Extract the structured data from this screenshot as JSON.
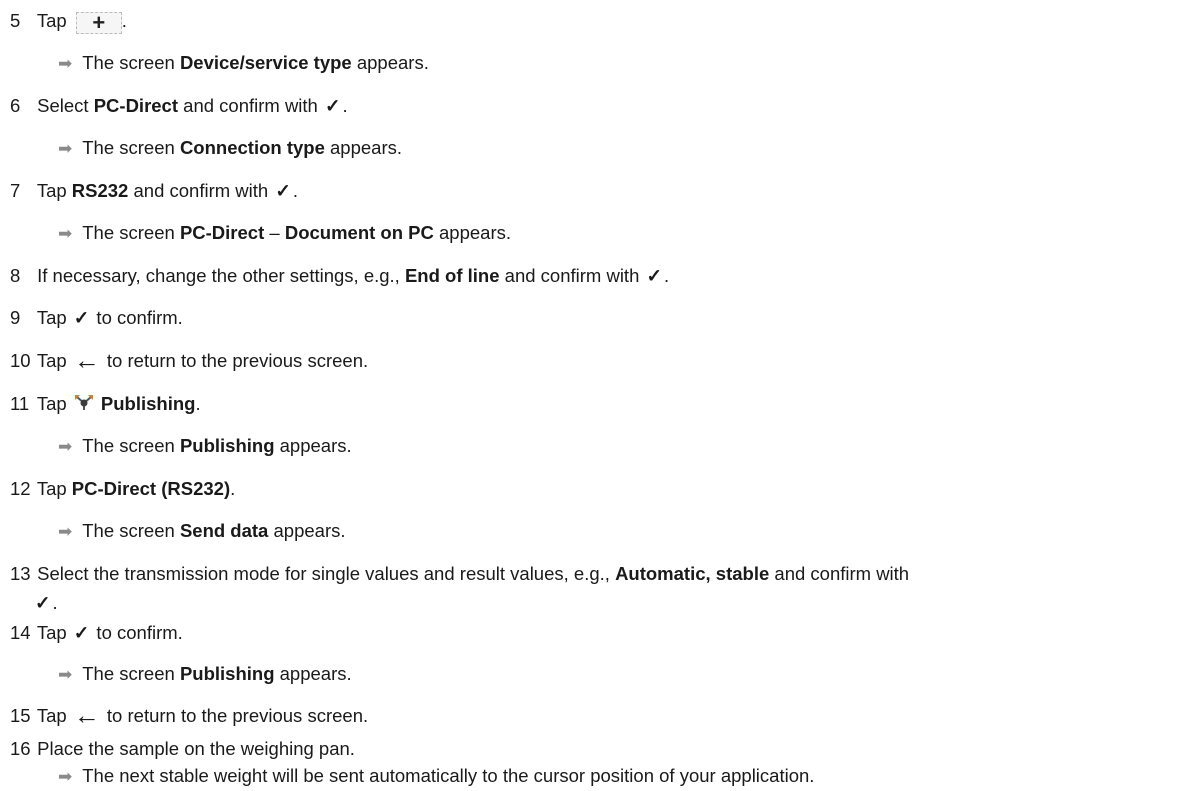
{
  "steps": [
    {
      "num": "5",
      "pre": "Tap",
      "post": ".",
      "icon": "plus-button-icon"
    },
    {
      "result": {
        "pre": "The screen ",
        "bold": "Device/service type",
        "post": " appears."
      }
    },
    {
      "num": "6",
      "pre": "Select ",
      "bold": "PC-Direct",
      "post": " and confirm with",
      "end": ".",
      "icon": "checkmark-icon"
    },
    {
      "result": {
        "pre": "The screen ",
        "bold": "Connection type",
        "post": " appears."
      }
    },
    {
      "num": "7",
      "pre": "Tap ",
      "bold": "RS232",
      "post": " and confirm with",
      "end": ".",
      "icon": "checkmark-icon"
    },
    {
      "result": {
        "pre": "The screen ",
        "bold": "PC-Direct",
        "mid": " – ",
        "bold2": "Document on PC",
        "post": " appears."
      }
    },
    {
      "num": "8",
      "pre": "If necessary, change the other settings, e.g., ",
      "bold": "End of line",
      "post": " and confirm with",
      "end": ".",
      "icon": "checkmark-icon"
    },
    {
      "num": "9",
      "pre": "Tap",
      "post": " to confirm.",
      "icon": "checkmark-icon"
    },
    {
      "num": "10",
      "pre": "Tap",
      "post": " to return to the previous screen.",
      "icon": "back-arrow-icon"
    },
    {
      "num": "11",
      "pre": "Tap",
      "bold": "Publishing",
      "post": ".",
      "icon": "publishing-icon"
    },
    {
      "result": {
        "pre": "The screen ",
        "bold": "Publishing",
        "post": " appears."
      }
    },
    {
      "num": "12",
      "pre": "Tap ",
      "bold": "PC-Direct (RS232)",
      "post": "."
    },
    {
      "result": {
        "pre": "The screen ",
        "bold": "Send data",
        "post": " appears."
      }
    },
    {
      "num": "13",
      "pre": "Select the transmission mode for single values and result values, e.g., ",
      "bold": "Automatic, stable",
      "post": " and confirm with",
      "end": ".",
      "icon": "checkmark-icon"
    },
    {
      "num": "14",
      "pre": "Tap",
      "post": " to confirm.",
      "icon": "checkmark-icon"
    },
    {
      "result": {
        "pre": "The screen ",
        "bold": "Publishing",
        "post": " appears."
      }
    },
    {
      "num": "15",
      "pre": "Tap",
      "post": " to return to the previous screen.",
      "icon": "back-arrow-icon"
    },
    {
      "num": "16",
      "pre": "Place the sample on the weighing pan."
    },
    {
      "result": {
        "pre": "The next stable weight will be sent automatically to the cursor position of your application."
      }
    }
  ],
  "icons": {
    "plus": "+",
    "check": "✓",
    "back": "←",
    "arrow": "➡"
  }
}
